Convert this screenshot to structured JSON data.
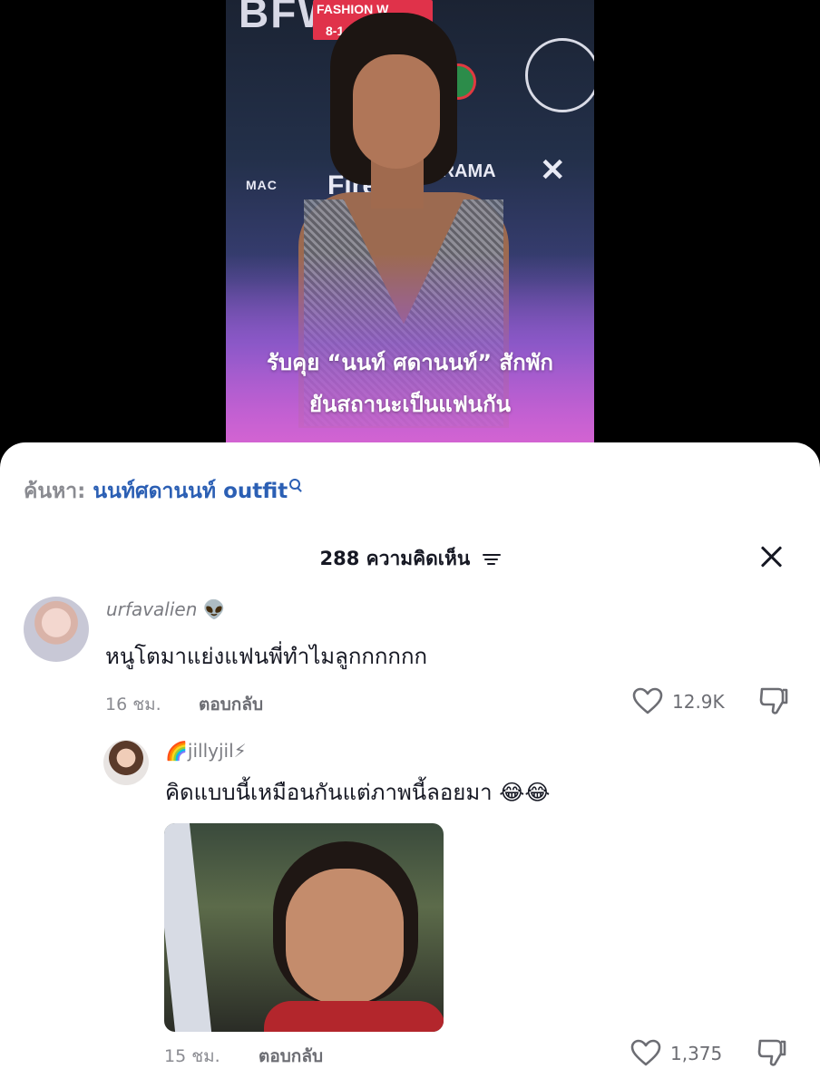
{
  "video": {
    "banner_bfw": "BFW",
    "banner_fashion": "FASHION W",
    "banner_date": "8-1",
    "banner_mac": "MAC",
    "banner_fire": "Fire",
    "banner_orama": "ORAMA",
    "banner_x": "✕",
    "caption_line1": "รับคุย “นนท์ ศดานนท์” สักพัก",
    "caption_line2": "ยันสถานะเป็นแฟนกัน"
  },
  "search": {
    "label": "ค้นหา:",
    "term": "นนท์ศดานนท์ outfit"
  },
  "comments_header": {
    "count": "288",
    "label": "ความคิดเห็น"
  },
  "comments": [
    {
      "username": "urfavalien",
      "username_emoji": "👽",
      "text": "หนูโตมาแย่งแฟนพี่ทำไมลูกกกกกก",
      "time": "16 ชม.",
      "reply_label": "ตอบกลับ",
      "likes": "12.9K"
    },
    {
      "username_prefix": "🌈",
      "username": "jillyjil",
      "username_suffix": "⚡",
      "text": "คิดแบบนี้เหมือนกันแต่ภาพนี้ลอยมา 😂😂",
      "time": "15 ชม.",
      "reply_label": "ตอบกลับ",
      "likes": "1,375"
    }
  ],
  "colors": {
    "accent": "#2b5fb4",
    "muted": "#8a8b91",
    "text": "#161823"
  }
}
